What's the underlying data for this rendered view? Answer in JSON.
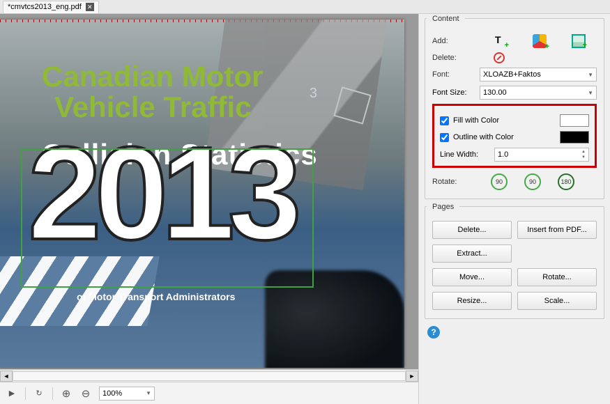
{
  "tab": {
    "filename": "*cmvtcs2013_eng.pdf"
  },
  "document": {
    "title_line1": "Canadian Motor",
    "title_line2": "Vehicle Traffic",
    "subtitle": "Collision Statistics",
    "big_text": "2013",
    "footer_line": "of Motor Transport Administrators",
    "ruler_marker": "3"
  },
  "toolbar": {
    "zoom": "100%"
  },
  "content_panel": {
    "title": "Content",
    "add_label": "Add:",
    "delete_label": "Delete:",
    "font_label": "Font:",
    "font_value": "XLOAZB+Faktos",
    "fontsize_label": "Font Size:",
    "fontsize_value": "130.00",
    "fill_label": "Fill with Color",
    "fill_checked": true,
    "fill_color": "#ffffff",
    "outline_label": "Outline with Color",
    "outline_checked": true,
    "outline_color": "#000000",
    "linewidth_label": "Line Width:",
    "linewidth_value": "1.0",
    "rotate_label": "Rotate:",
    "rotate_options": [
      "90",
      "90",
      "180"
    ]
  },
  "pages_panel": {
    "title": "Pages",
    "buttons": {
      "delete": "Delete...",
      "insert": "Insert from PDF...",
      "extract": "Extract...",
      "move": "Move...",
      "rotate": "Rotate...",
      "resize": "Resize...",
      "scale": "Scale..."
    }
  }
}
